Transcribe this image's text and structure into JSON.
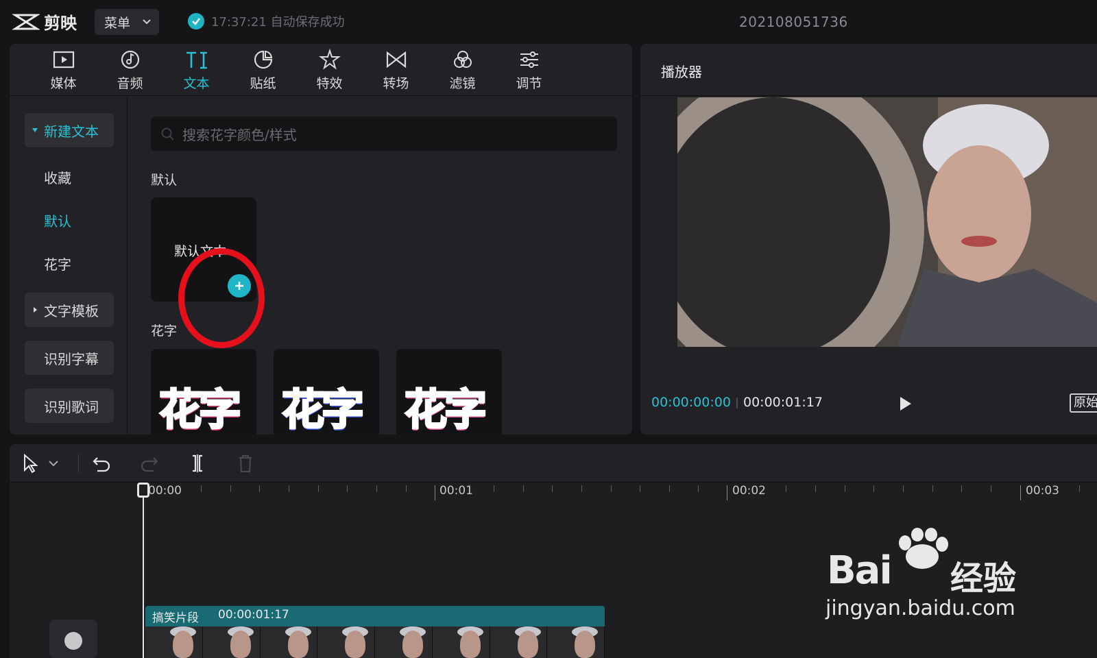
{
  "app": {
    "logo_text": "剪映",
    "menu_label": "菜单",
    "save_status": "17:37:21 自动保存成功",
    "project_name": "202108051736"
  },
  "toolbar": {
    "items": [
      {
        "label": "媒体",
        "icon": "media-icon"
      },
      {
        "label": "音频",
        "icon": "audio-icon"
      },
      {
        "label": "文本",
        "icon": "text-icon",
        "active": true
      },
      {
        "label": "贴纸",
        "icon": "sticker-icon"
      },
      {
        "label": "特效",
        "icon": "effects-icon"
      },
      {
        "label": "转场",
        "icon": "transition-icon"
      },
      {
        "label": "滤镜",
        "icon": "filter-icon"
      },
      {
        "label": "调节",
        "icon": "adjust-icon"
      }
    ]
  },
  "sidebar": {
    "items": [
      {
        "label": "新建文本",
        "active": true
      },
      {
        "label": "收藏"
      },
      {
        "label": "默认",
        "active": true
      },
      {
        "label": "花字"
      },
      {
        "label": "文字模板"
      },
      {
        "label": "识别字幕"
      },
      {
        "label": "识别歌词"
      }
    ]
  },
  "content": {
    "search_placeholder": "搜索花字颜色/样式",
    "section_default": "默认",
    "default_card_label": "默认文本",
    "section_flower": "花字",
    "flower_cards": [
      "花字",
      "花字",
      "花字"
    ]
  },
  "player": {
    "title": "播放器",
    "time_current": "00:00:00:00",
    "time_total": "00:00:01:17",
    "ratio_label": "原始"
  },
  "timeline": {
    "ruler": [
      "00:00",
      "00:01",
      "00:02",
      "00:03"
    ],
    "clip_name": "搞笑片段",
    "clip_duration": "00:00:01:17"
  },
  "watermark": {
    "brand": "Bai",
    "cn": "经验",
    "url": "jingyan.baidu.com"
  },
  "colors": {
    "accent": "#2ac0d0",
    "highlight_ring": "#e6101c",
    "clip": "#1a6a73"
  }
}
